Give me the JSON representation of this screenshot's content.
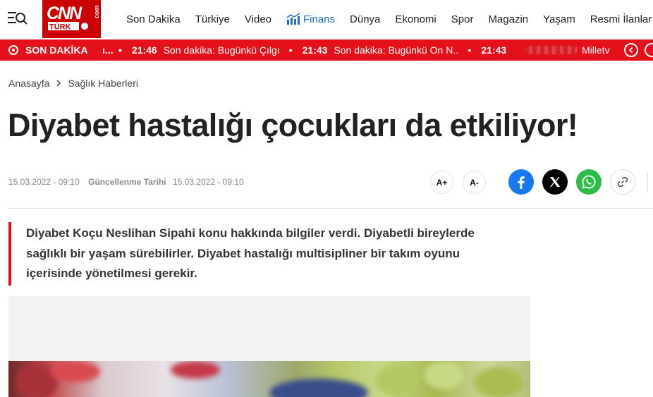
{
  "header": {
    "nav": [
      "Son Dakika",
      "Türkiye",
      "Video",
      "Finans",
      "Dünya",
      "Ekonomi",
      "Spor",
      "Magazin",
      "Yaşam",
      "Resmi İlanlar"
    ],
    "logo_text": "CNN TÜRK .com"
  },
  "breaking": {
    "title": "SON DAKİKA",
    "fragment": "ı...",
    "items": [
      {
        "time": "21:46",
        "text": "Son dakika: Bugünkü Çılgın..."
      },
      {
        "time": "21:43",
        "text": "Son dakika: Bugünkü On N..."
      },
      {
        "time": "21:43",
        "text": ""
      }
    ],
    "source": "Milletv"
  },
  "breadcrumb": {
    "home": "Anasayfa",
    "category": "Sağlık Haberleri"
  },
  "article": {
    "title": "Diyabet hastalığı çocukları da etkiliyor!",
    "published": "15.03.2022 - 09:10",
    "updated_label": "Güncellenme Tarihi",
    "updated": "15.03.2022 - 09:10",
    "summary": "Diyabet Koçu Neslihan Sipahi konu hakkında bilgiler verdi.  Diyabetli bireylerde sağlıklı bir yaşam sürebilirler. Diyabet hastalığı multisipliner bir takım oyunu içerisinde yönetilmesi gerekir."
  },
  "toolbar": {
    "font_increase": "A+",
    "font_decrease": "A-"
  },
  "colors": {
    "brand_red": "#e4111b",
    "facebook": "#1a77f2",
    "whatsapp": "#2dbd46",
    "finans_blue": "#1b6fc6"
  }
}
